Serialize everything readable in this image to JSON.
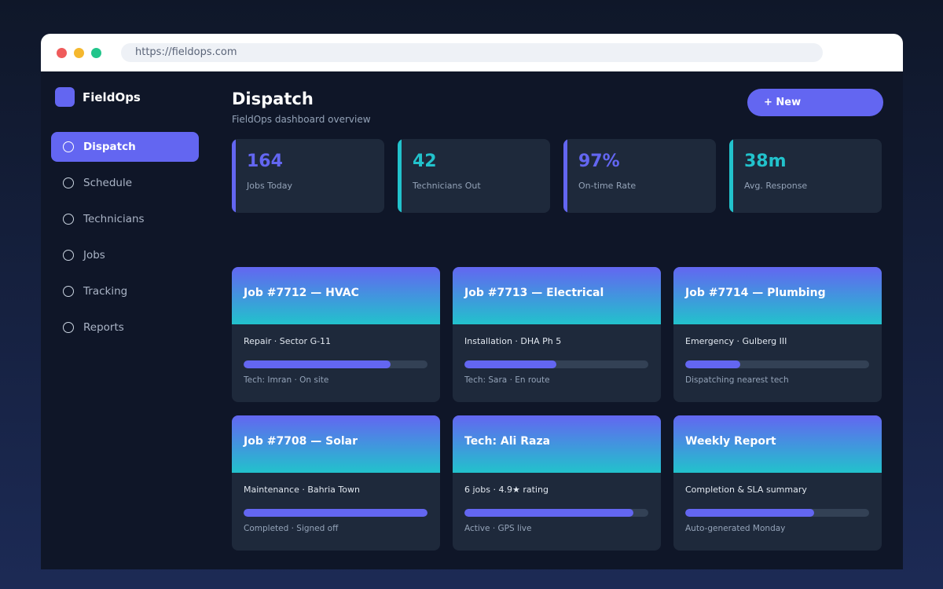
{
  "browser": {
    "url": "https://fieldops.com"
  },
  "brand": {
    "name": "FieldOps"
  },
  "sidebar": {
    "items": [
      {
        "label": "Dispatch",
        "active": true
      },
      {
        "label": "Schedule"
      },
      {
        "label": "Technicians"
      },
      {
        "label": "Jobs"
      },
      {
        "label": "Tracking"
      },
      {
        "label": "Reports"
      }
    ]
  },
  "header": {
    "title": "Dispatch",
    "subtitle": "FieldOps dashboard overview",
    "new_button": "+ New"
  },
  "stats": [
    {
      "value": "164",
      "label": "Jobs Today",
      "color": "#6366f1"
    },
    {
      "value": "42",
      "label": "Technicians Out",
      "color": "#22c2cc"
    },
    {
      "value": "97%",
      "label": "On-time Rate",
      "color": "#6366f1"
    },
    {
      "value": "38m",
      "label": "Avg. Response",
      "color": "#22c2cc"
    }
  ],
  "cards": [
    {
      "title": "Job #7712 — HVAC",
      "subtitle": "Repair · Sector G-11",
      "progress": 0.8,
      "footer": "Tech: Imran · On site"
    },
    {
      "title": "Job #7713 — Electrical",
      "subtitle": "Installation · DHA Ph 5",
      "progress": 0.5,
      "footer": "Tech: Sara · En route"
    },
    {
      "title": "Job #7714 — Plumbing",
      "subtitle": "Emergency · Gulberg III",
      "progress": 0.3,
      "footer": "Dispatching nearest tech"
    },
    {
      "title": "Job #7708 — Solar",
      "subtitle": "Maintenance · Bahria Town",
      "progress": 1.0,
      "footer": "Completed · Signed off"
    },
    {
      "title": "Tech: Ali Raza",
      "subtitle": "6 jobs · 4.9★ rating",
      "progress": 0.92,
      "footer": "Active · GPS live"
    },
    {
      "title": "Weekly Report",
      "subtitle": "Completion & SLA summary",
      "progress": 0.7,
      "footer": "Auto-generated Monday"
    }
  ],
  "colors": {
    "accent": "#6366f1",
    "teal": "#22c2cc"
  }
}
